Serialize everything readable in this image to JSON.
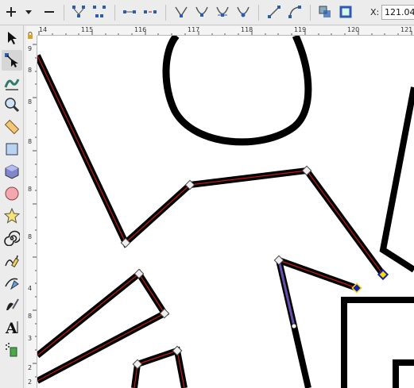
{
  "toolbar": {
    "buttons": [
      "insert-node-icon",
      "menu-arrow-icon",
      "delete-node-icon",
      "join-nodes-icon",
      "break-path-icon",
      "join-segment-icon",
      "delete-segment-icon",
      "make-cusp-icon",
      "make-smooth-icon",
      "make-symmetric-icon",
      "make-auto-smooth-icon",
      "make-line-icon",
      "make-curve-icon",
      "object-to-path-icon",
      "stroke-to-path-icon"
    ],
    "x_label": "X:",
    "x_value": "121.04"
  },
  "tools": [
    "selector-tool",
    "node-tool",
    "tweak-tool",
    "zoom-tool",
    "measure-tool",
    "rectangle-tool",
    "box-3d-tool",
    "ellipse-tool",
    "star-tool",
    "spiral-tool",
    "pencil-tool",
    "pen-tool",
    "calligraphy-tool",
    "text-tool",
    "spray-tool"
  ],
  "ruler": {
    "h_labels": [
      "14",
      "115",
      "116",
      "117",
      "118",
      "119",
      "120",
      "121"
    ],
    "v_labels": [
      "9",
      "8",
      "8",
      "8",
      "8",
      "8",
      "4",
      "8",
      "3",
      "2",
      "2"
    ]
  }
}
